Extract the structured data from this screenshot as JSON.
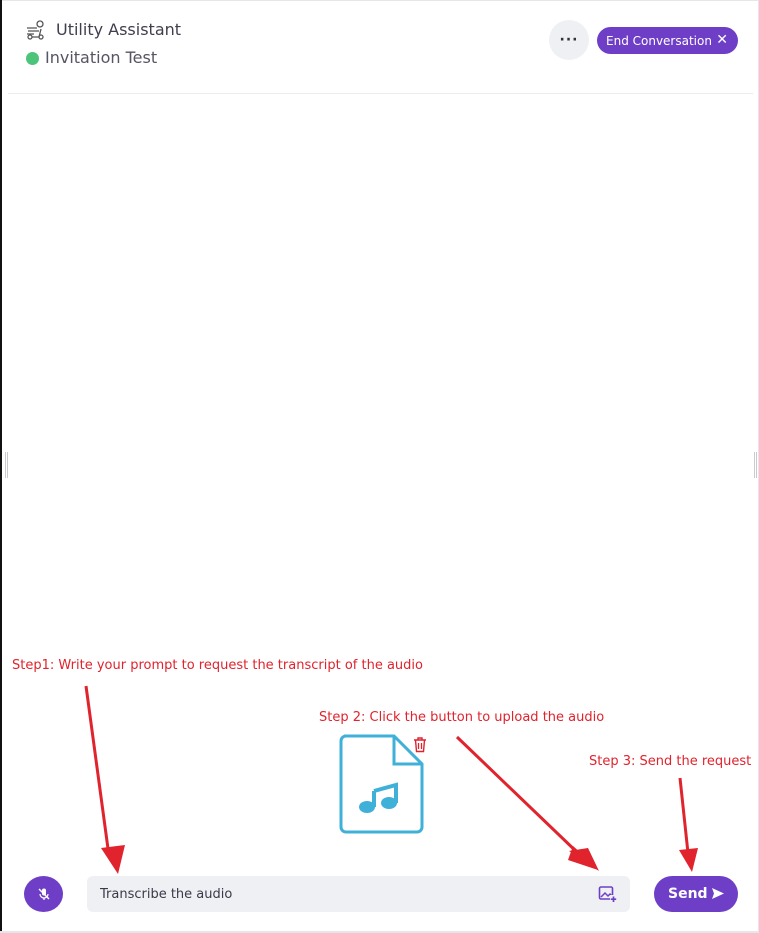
{
  "header": {
    "bot_icon": "robot-bike-icon",
    "bot_name": "Utility Assistant",
    "status_text": "Invitation Test",
    "status_color": "#4cc57a",
    "more_label": "···",
    "end_label": "End Conversation",
    "end_close": "✕"
  },
  "annotations": {
    "step1": "Step1: Write your prompt to request the transcript of the audio",
    "step2": "Step 2: Click the button to upload the audio",
    "step3": "Step 3: Send the request",
    "color": "#e0232d"
  },
  "attachment": {
    "file_icon": "audio-file-icon",
    "delete_icon": "trash-icon"
  },
  "composer": {
    "mic_icon": "mic-off-icon",
    "input_value": "Transcribe the audio",
    "upload_icon": "image-upload-icon",
    "send_label": "Send",
    "send_icon": "send-icon"
  },
  "colors": {
    "accent": "#6e3fc6",
    "file_icon": "#3fb0d8"
  }
}
